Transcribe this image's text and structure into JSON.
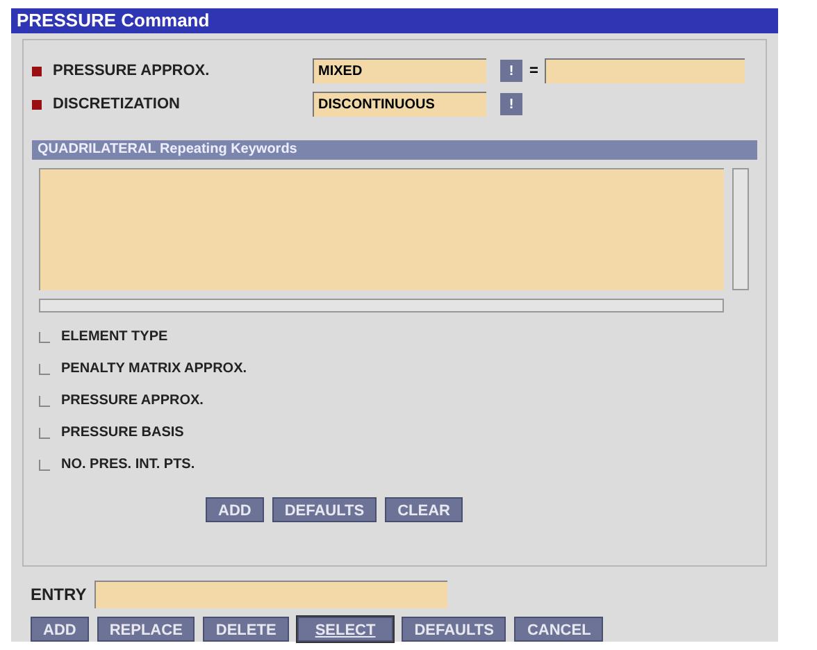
{
  "window": {
    "title": "PRESSURE Command"
  },
  "params": [
    {
      "label": "PRESSURE APPROX.",
      "value": "MIXED",
      "help": "!",
      "extra": {
        "sign": "="
      }
    },
    {
      "label": "DISCRETIZATION",
      "value": "DISCONTINUOUS",
      "help": "!"
    }
  ],
  "section": {
    "title": "QUADRILATERAL Repeating Keywords",
    "options": [
      {
        "label": "ELEMENT TYPE",
        "checked": false
      },
      {
        "label": "PENALTY MATRIX APPROX.",
        "checked": false
      },
      {
        "label": "PRESSURE APPROX.",
        "checked": false
      },
      {
        "label": "PRESSURE BASIS",
        "checked": false
      },
      {
        "label": "NO. PRES. INT. PTS.",
        "checked": false
      }
    ],
    "buttons": [
      "ADD",
      "DEFAULTS",
      "CLEAR"
    ]
  },
  "entry": {
    "label": "ENTRY"
  },
  "buttons": [
    {
      "label": "ADD",
      "selected": false
    },
    {
      "label": "REPLACE",
      "selected": false
    },
    {
      "label": "DELETE",
      "selected": false
    },
    {
      "label": "SELECT",
      "selected": true
    },
    {
      "label": "DEFAULTS",
      "selected": false
    },
    {
      "label": "CANCEL",
      "selected": false
    }
  ]
}
